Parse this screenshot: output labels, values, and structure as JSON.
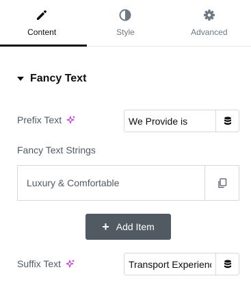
{
  "tabs": [
    {
      "label": "Content",
      "icon": "pencil-icon",
      "active": true
    },
    {
      "label": "Style",
      "icon": "half-circle-icon",
      "active": false
    },
    {
      "label": "Advanced",
      "icon": "gear-icon",
      "active": false
    }
  ],
  "section": {
    "title": "Fancy Text"
  },
  "prefix": {
    "label": "Prefix Text",
    "value": "We Provide is"
  },
  "strings": {
    "label": "Fancy Text Strings",
    "items": [
      {
        "title": "Luxury & Comfortable"
      }
    ]
  },
  "add_item": {
    "label": "Add Item"
  },
  "suffix": {
    "label": "Suffix Text",
    "value": "Transport Experience"
  },
  "colors": {
    "accent": "#c036d6",
    "text": "#515962",
    "button": "#515962"
  }
}
